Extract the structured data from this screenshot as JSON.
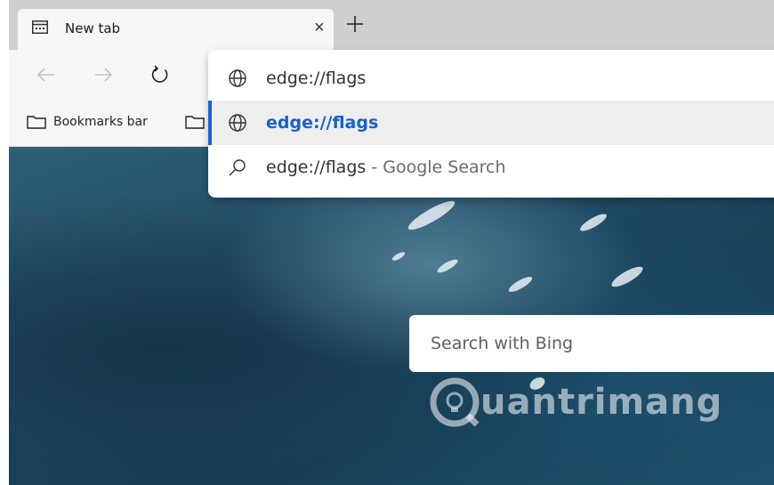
{
  "tab": {
    "title": "New tab",
    "close_glyph": "×",
    "icon": "newtab-page-icon"
  },
  "toolbar": {
    "back_icon": "back-arrow-icon",
    "forward_icon": "forward-arrow-icon",
    "refresh_icon": "refresh-icon"
  },
  "bookmarks": {
    "bar_label": "Bookmarks bar"
  },
  "omnibox": {
    "input_text": "edge://flags",
    "suggestions": [
      {
        "type": "url",
        "text": "edge://flags",
        "icon": "globe-icon"
      },
      {
        "type": "search",
        "query": "edge://flags",
        "suffix": " - Google Search",
        "icon": "search-icon"
      }
    ]
  },
  "page": {
    "search_placeholder": "Search with Bing",
    "watermark": "uantrimang"
  },
  "colors": {
    "accent": "#1a64d4",
    "tabstrip": "#cfcfcf",
    "toolbar": "#f7f7f7"
  }
}
